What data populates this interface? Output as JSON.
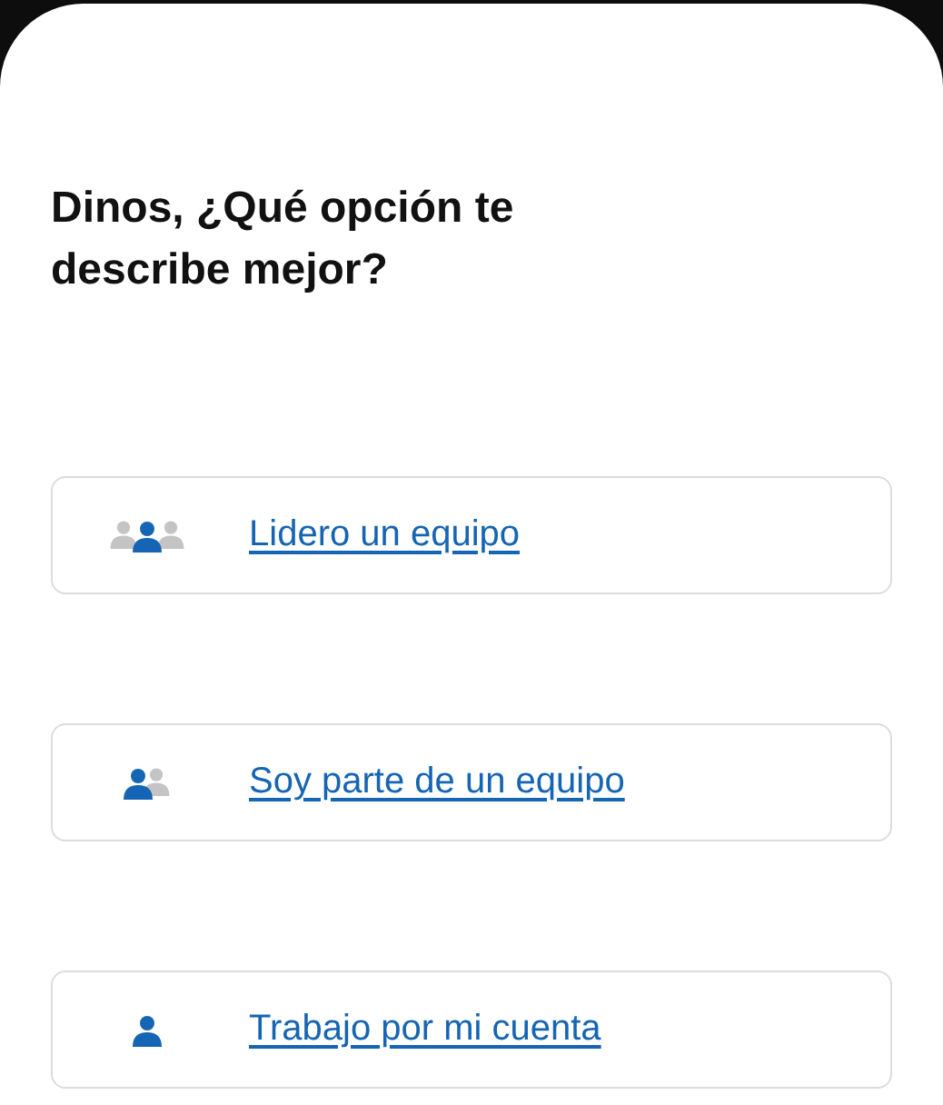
{
  "title": "Dinos, ¿Qué opción te describe mejor?",
  "options": [
    {
      "kind": "lead",
      "label": "Lidero un equipo"
    },
    {
      "kind": "member",
      "label": "Soy parte de un equipo"
    },
    {
      "kind": "solo",
      "label": "Trabajo por mi cuenta"
    }
  ]
}
